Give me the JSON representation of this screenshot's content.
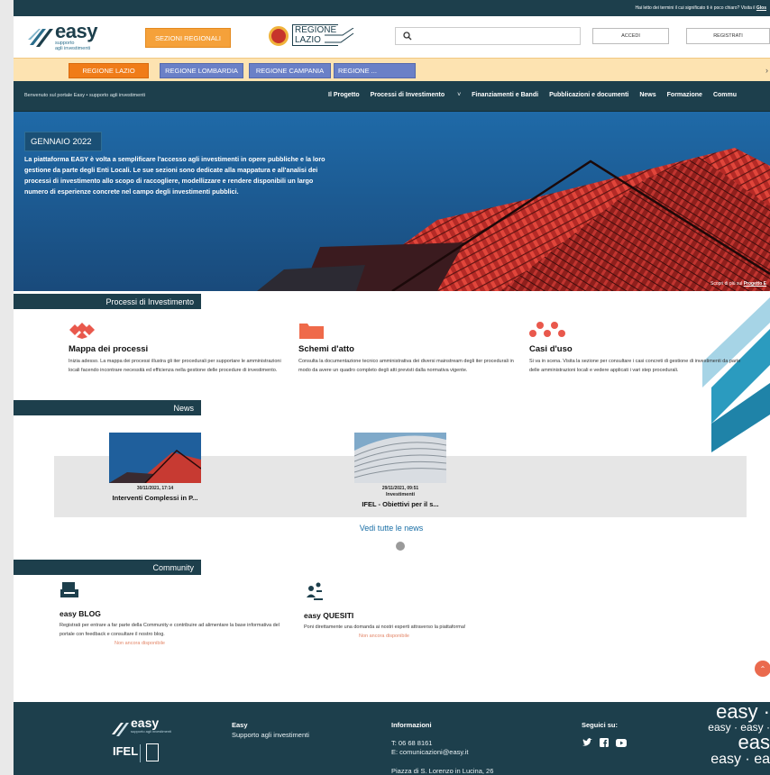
{
  "notice": {
    "text": "Hai letto dei termini il cui significato ti è poco chiaro? Visita il",
    "link": "Glos"
  },
  "header": {
    "logo": {
      "word": "easy",
      "tagline_1": "supporto",
      "tagline_2": "agli investimenti"
    },
    "sezioni_button": "SEZIONI REGIONALI",
    "region_logo": {
      "line1": "REGIONE",
      "line2": "LAZIO"
    },
    "search": {
      "value": "",
      "placeholder": ""
    },
    "accedi": "ACCEDI",
    "registrati": "REGISTRATI"
  },
  "regions": [
    {
      "label": "REGIONE LAZIO",
      "active": true
    },
    {
      "label": "REGIONE LOMBARDIA",
      "active": false
    },
    {
      "label": "REGIONE CAMPANIA",
      "active": false
    },
    {
      "label": "REGIONE ...",
      "active": false
    }
  ],
  "nav": {
    "welcome": "Benvenuto sul portale Easy • supporto agli investimenti",
    "items": [
      "Il Progetto",
      "Processi di Investimento",
      "Finanziamenti e Bandi",
      "Pubblicazioni e documenti",
      "News",
      "Formazione",
      "Commu"
    ]
  },
  "hero": {
    "date": "GENNAIO 2022",
    "desc": "La piattaforma EASY è volta a semplificare l'accesso agli investimenti in opere pubbliche e la loro gestione da parte degli Enti Locali. Le sue sezioni sono dedicate alla mappatura e all'analisi dei processi di investimento allo scopo di raccogliere, modellizzare e rendere disponibili un largo numero di esperienze concrete nel campo degli investimenti pubblici.",
    "more_prefix": "Scopri di più sul",
    "more_link": "Progetto E"
  },
  "processi": {
    "title": "Processi di Investimento",
    "cards": [
      {
        "title": "Mappa dei processi",
        "text": "Inizia adesso. La mappa dei processi illustra gli iter procedurali per supportare le amministrazioni locali facendo incontrare necessità ed efficienza nella gestione delle procedure di investimento."
      },
      {
        "title": "Schemi d'atto",
        "text": "Consulta la documentazione tecnico amministrativa dei diversi mainstream degli iter procedurali in modo da avere un quadro completo degli atti previsti dalla normativa vigente."
      },
      {
        "title": "Casi d'uso",
        "text": "Si va in scena. Visita la sezione per consultare i casi concreti di gestione di investimenti da parte delle amministrazioni locali e vedere applicati i vari step procedurali."
      }
    ]
  },
  "news": {
    "title": "News",
    "items": [
      {
        "date": "30/11/2021, 17:14",
        "category": "",
        "title": "Interventi Complessi in P..."
      },
      {
        "date": "29/11/2021, 09:51",
        "category": "Investimenti",
        "title": "IFEL - Obiettivi per il s..."
      }
    ],
    "all_label": "Vedi tutte le news"
  },
  "community": {
    "title": "Community",
    "items": [
      {
        "title": "easy BLOG",
        "text": "Registrati per entrare a far parte della Community e contribuire ad alimentare la base informativa del portale con feedback e consultare il nostro blog.",
        "status": "Non ancora disponibile"
      },
      {
        "title": "easy QUESITI",
        "text": "Poni direttamente una domanda ai nostri esperti attraverso la piattaforma!",
        "status": "Non ancora disponibile"
      }
    ]
  },
  "footer": {
    "logo_word": "easy",
    "logo_tag": "supporto agli investimenti",
    "ifel": "IFEL",
    "easy_title": "Easy",
    "easy_sub": "Supporto agli investimenti",
    "info_title": "Informazioni",
    "phone": "T: 06 68 8161",
    "email": "E: comunicazioni@easy.it",
    "address": "Piazza di S. Lorenzo in Lucina, 26",
    "follow": "Seguici su:",
    "brand_lines": [
      "easy ·",
      "easy · easy ·",
      "eas",
      "easy · ea"
    ]
  },
  "colors": {
    "primary": "#1d3f4c",
    "accent_orange": "#f07c18",
    "region_blue": "#6a80c7",
    "link": "#1a6fa6",
    "muted_red": "#e38668",
    "teal": "#2b9bbf"
  },
  "icons": [
    "search-icon",
    "mappa-icon",
    "folder-icon",
    "casi-icon",
    "blog-icon",
    "quesiti-icon",
    "twitter-icon",
    "facebook-icon",
    "youtube-icon",
    "chevron-up-icon",
    "chevron-right-icon",
    "chevron-down-icon"
  ]
}
